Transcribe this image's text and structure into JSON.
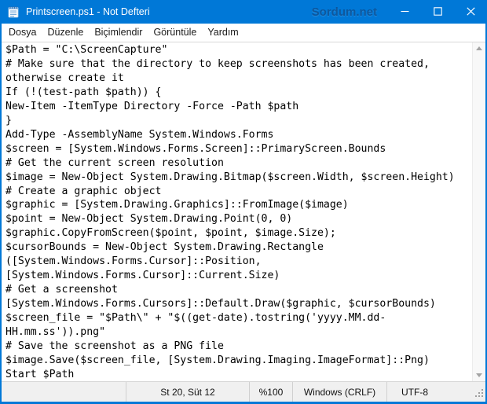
{
  "window": {
    "title": "Printscreen.ps1 - Not Defteri",
    "watermark": "Sordum.net"
  },
  "menu": {
    "items": [
      "Dosya",
      "Düzenle",
      "Biçimlendir",
      "Görüntüle",
      "Yardım"
    ]
  },
  "editor": {
    "lines": [
      "$Path = \"C:\\ScreenCapture\"",
      "# Make sure that the directory to keep screenshots has been created,",
      "otherwise create it",
      "If (!(test-path $path)) {",
      "New-Item -ItemType Directory -Force -Path $path",
      "}",
      "Add-Type -AssemblyName System.Windows.Forms",
      "$screen = [System.Windows.Forms.Screen]::PrimaryScreen.Bounds",
      "# Get the current screen resolution",
      "$image = New-Object System.Drawing.Bitmap($screen.Width, $screen.Height)",
      "# Create a graphic object",
      "$graphic = [System.Drawing.Graphics]::FromImage($image)",
      "$point = New-Object System.Drawing.Point(0, 0)",
      "$graphic.CopyFromScreen($point, $point, $image.Size);",
      "$cursorBounds = New-Object System.Drawing.Rectangle",
      "([System.Windows.Forms.Cursor]::Position,",
      "[System.Windows.Forms.Cursor]::Current.Size)",
      "# Get a screenshot",
      "[System.Windows.Forms.Cursors]::Default.Draw($graphic, $cursorBounds)",
      "$screen_file = \"$Path\\\" + \"$((get-date).tostring('yyyy.MM.dd-",
      "HH.mm.ss')).png\"",
      "# Save the screenshot as a PNG file",
      "$image.Save($screen_file, [System.Drawing.Imaging.ImageFormat]::Png)",
      "Start $Path"
    ]
  },
  "status": {
    "cursor_position": "St 20, Süt 12",
    "zoom_level": "%100",
    "line_ending": "Windows (CRLF)",
    "encoding": "UTF-8"
  },
  "colors": {
    "titlebar_blue": "#0078d7",
    "watermark_blue": "#0a4a8c",
    "statusbar_bg": "#f0f0f0",
    "editor_bg": "#ffffff"
  }
}
